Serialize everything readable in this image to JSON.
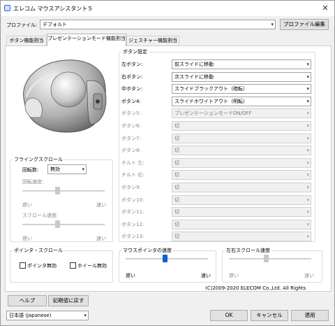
{
  "window": {
    "title": "エレコム マウスアシスタント５",
    "close": "✕"
  },
  "profile": {
    "label": "プロファイル:",
    "value": "デフォルト",
    "edit_button": "プロファイル編集"
  },
  "tabs": [
    {
      "label": "ボタン機能割当"
    },
    {
      "label": "プレゼンテーションモード機能割当"
    },
    {
      "label": "ジェスチャー機能割当"
    }
  ],
  "button_settings": {
    "title": "ボタン設定",
    "rows": [
      {
        "label": "左ボタン:",
        "value": "前スライドに移動",
        "enabled": true
      },
      {
        "label": "右ボタン:",
        "value": "次スライドに移動",
        "enabled": true
      },
      {
        "label": "中ボタン:",
        "value": "スライドブラックアウト（暗転）",
        "enabled": true
      },
      {
        "label": "ボタン4:",
        "value": "スライドホワイトアウト（明転）",
        "enabled": true
      },
      {
        "label": "ボタン5:",
        "value": "プレゼンテーションモードON/OFF",
        "enabled": false
      },
      {
        "label": "ボタン6:",
        "value": "切",
        "enabled": false
      },
      {
        "label": "ボタン7:",
        "value": "切",
        "enabled": false
      },
      {
        "label": "ボタン8:",
        "value": "切",
        "enabled": false
      },
      {
        "label": "チルト 左:",
        "value": "切",
        "enabled": false
      },
      {
        "label": "チルト 右:",
        "value": "切",
        "enabled": false
      },
      {
        "label": "ボタン9:",
        "value": "切",
        "enabled": false
      },
      {
        "label": "ボタン10:",
        "value": "切",
        "enabled": false
      },
      {
        "label": "ボタン11:",
        "value": "切",
        "enabled": false
      },
      {
        "label": "ボタン12:",
        "value": "切",
        "enabled": false
      },
      {
        "label": "ボタン13:",
        "value": "切",
        "enabled": false
      }
    ]
  },
  "flying_scroll": {
    "title": "フライングスクロール",
    "rotation_label": "回転数:",
    "rotation_value": "無効",
    "rotation_speed_label": "回転速度:",
    "scroll_speed_label": "スクロール速度:",
    "slow": "遅い",
    "fast": "速い"
  },
  "pointer_scroll": {
    "title": "ポインタ・スクロール",
    "pointer_disable": "ポインタ無効",
    "wheel_disable": "ホイール無効"
  },
  "pointer_speed": {
    "title": "マウスポインタの速度",
    "slow": "遅い",
    "fast": "速い"
  },
  "horizontal_scroll": {
    "title": "左右スクロール速度",
    "slow": "遅い",
    "fast": "速い"
  },
  "copyright": "(C)2009-2020 ELECOM Co.,Ltd. All Rights",
  "footer": {
    "help": "ヘルプ",
    "reset": "初期値に戻す",
    "language": "日本語 (Japanese)",
    "ok": "OK",
    "cancel": "キャンセル",
    "apply": "適用"
  },
  "icons": {
    "dropdown": "▾"
  }
}
